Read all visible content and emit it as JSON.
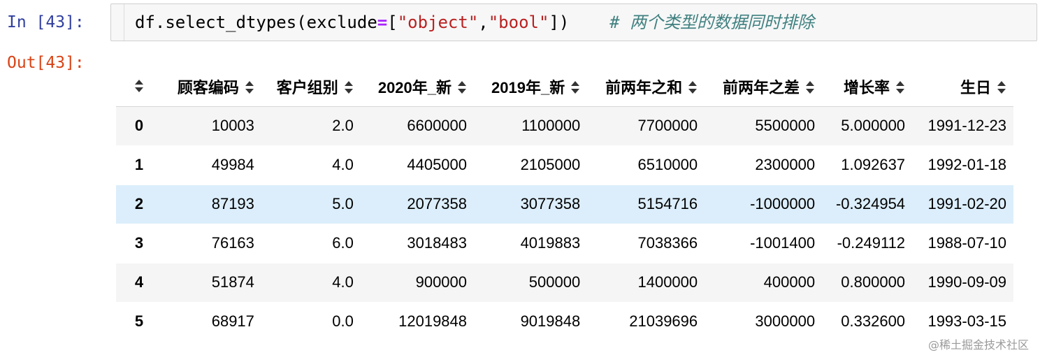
{
  "input_cell": {
    "prompt": "In [43]:",
    "code_tokens": [
      {
        "t": "df.select_dtypes(exclude",
        "c": "plain"
      },
      {
        "t": "=",
        "c": "op"
      },
      {
        "t": "[",
        "c": "plain"
      },
      {
        "t": "\"object\"",
        "c": "str"
      },
      {
        "t": ",",
        "c": "plain"
      },
      {
        "t": "\"bool\"",
        "c": "str"
      },
      {
        "t": "])",
        "c": "plain"
      },
      {
        "t": "    ",
        "c": "plain"
      },
      {
        "t": "# 两个类型的数据同时排除",
        "c": "comment"
      }
    ]
  },
  "output_cell": {
    "prompt": "Out[43]:"
  },
  "table": {
    "columns": [
      "顾客编码",
      "客户组别",
      "2020年_新",
      "2019年_新",
      "前两年之和",
      "前两年之差",
      "增长率",
      "生日"
    ],
    "rows": [
      {
        "index": "0",
        "cells": [
          "10003",
          "2.0",
          "6600000",
          "1100000",
          "7700000",
          "5500000",
          "5.000000",
          "1991-12-23"
        ]
      },
      {
        "index": "1",
        "cells": [
          "49984",
          "4.0",
          "4405000",
          "2105000",
          "6510000",
          "2300000",
          "1.092637",
          "1992-01-18"
        ]
      },
      {
        "index": "2",
        "cells": [
          "87193",
          "5.0",
          "2077358",
          "3077358",
          "5154716",
          "-1000000",
          "-0.324954",
          "1991-02-20"
        ],
        "highlighted": true
      },
      {
        "index": "3",
        "cells": [
          "76163",
          "6.0",
          "3018483",
          "4019883",
          "7038366",
          "-1001400",
          "-0.249112",
          "1988-07-10"
        ]
      },
      {
        "index": "4",
        "cells": [
          "51874",
          "4.0",
          "900000",
          "500000",
          "1400000",
          "400000",
          "0.800000",
          "1990-09-09"
        ]
      },
      {
        "index": "5",
        "cells": [
          "68917",
          "0.0",
          "12019848",
          "9019848",
          "21039696",
          "3000000",
          "0.332600",
          "1993-03-15"
        ]
      }
    ]
  },
  "watermark": "@稀土掘金技术社区",
  "colors": {
    "in_prompt": "#303f9f",
    "out_prompt": "#d84315",
    "string": "#ba2121",
    "operator": "#aa22ff",
    "comment": "#408080",
    "row_highlight": "#dceefb"
  },
  "icons": {
    "sort": "sort-arrows-icon"
  }
}
